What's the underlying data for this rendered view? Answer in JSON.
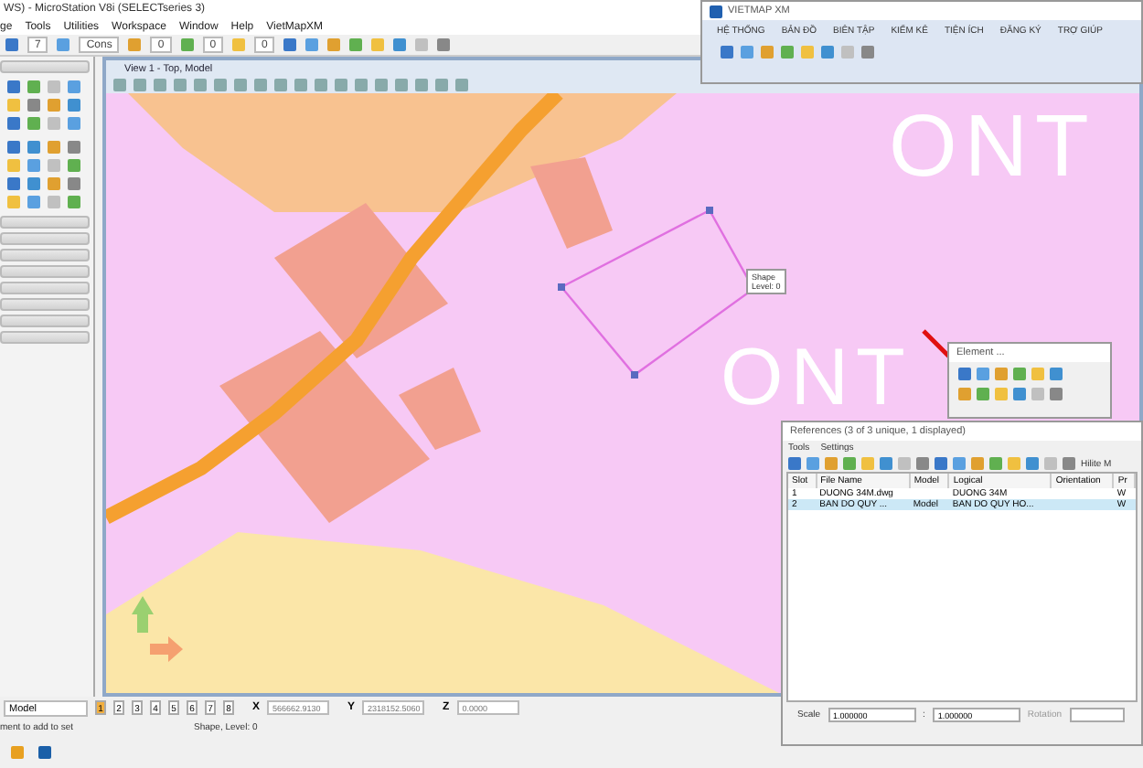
{
  "app_window": {
    "title": "WS) - MicroStation V8i (SELECTseries 3)"
  },
  "menu": [
    "ge",
    "Tools",
    "Utilities",
    "Workspace",
    "Window",
    "Help",
    "VietMapXM"
  ],
  "toolbar": {
    "fields": [
      "7",
      "Cons",
      "0",
      "0",
      "0"
    ]
  },
  "view": {
    "title": "View 1 - Top, Model",
    "map_labels": [
      "ONT",
      "ONT"
    ],
    "tooltip": [
      "Shape",
      "Level: 0"
    ]
  },
  "status": {
    "model": "Model",
    "views": [
      {
        "label": "1",
        "selected": true
      },
      {
        "label": "2",
        "selected": false
      },
      {
        "label": "3",
        "selected": false
      },
      {
        "label": "4",
        "selected": false
      },
      {
        "label": "5",
        "selected": false
      },
      {
        "label": "6",
        "selected": false
      },
      {
        "label": "7",
        "selected": false
      },
      {
        "label": "8",
        "selected": false
      }
    ],
    "coords": [
      {
        "axis": "X",
        "value": "566662.9130"
      },
      {
        "axis": "Y",
        "value": "2318152.5060"
      },
      {
        "axis": "Z",
        "value": "0.0000"
      }
    ]
  },
  "message": {
    "prompt": "ment to add to set",
    "info": "Shape, Level: 0"
  },
  "vietmap": {
    "title": "VIETMAP XM",
    "menu": [
      "HỆ THỐNG",
      "BẢN ĐỒ",
      "BIÊN TẬP",
      "KIỂM KÊ",
      "TIỆN ÍCH",
      "ĐĂNG KÝ",
      "TRỢ GIÚP"
    ]
  },
  "element_dialog": {
    "title": "Element ..."
  },
  "references": {
    "title": "References (3 of 3 unique, 1 displayed)",
    "menu": [
      "Tools",
      "Settings"
    ],
    "toolbar_text": "Hilite M",
    "columns": [
      "Slot",
      "File Name",
      "Model",
      "Logical",
      "Orientation",
      "Pr"
    ],
    "rows": [
      {
        "cells": [
          "1",
          "DUONG 34M.dwg",
          "",
          "DUONG 34M",
          "",
          "W"
        ],
        "selected": false
      },
      {
        "cells": [
          "2",
          "BAN DO QUY ...",
          "Model",
          "BAN DO QUY HO...",
          "",
          "W"
        ],
        "selected": true
      }
    ],
    "scale_label": "Scale",
    "scale_a": "1.000000",
    "separator": ":",
    "scale_b": "1.000000",
    "rotation_label": "Rotation"
  }
}
